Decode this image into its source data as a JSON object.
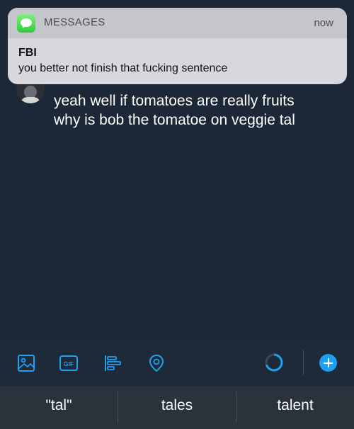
{
  "notification": {
    "app_name": "MESSAGES",
    "time": "now",
    "sender": "FBI",
    "message": "you better not finish that fucking sentence",
    "app_icon": "messages-bubble-icon"
  },
  "compose": {
    "text": "yeah well if tomatoes are really fruits\nwhy is bob the tomatoe on veggie tal"
  },
  "toolbar": {
    "icons": [
      "image-icon",
      "gif-icon",
      "poll-icon",
      "location-icon"
    ],
    "gif_label": "GIF",
    "add_button_icon": "plus-icon"
  },
  "keyboard": {
    "suggestions": [
      "\"tal\"",
      "tales",
      "talent"
    ]
  },
  "colors": {
    "accent": "#1da1f2",
    "background": "#1c2837",
    "keyboard_bar": "#2a323c"
  }
}
